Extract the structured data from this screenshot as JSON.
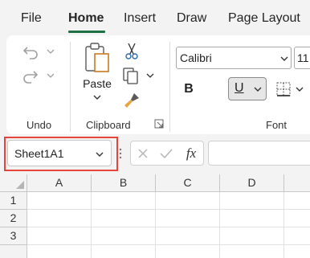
{
  "menu": {
    "tabs": [
      {
        "label": "File"
      },
      {
        "label": "Home"
      },
      {
        "label": "Insert"
      },
      {
        "label": "Draw"
      },
      {
        "label": "Page Layout"
      }
    ],
    "active_tab": "Home"
  },
  "ribbon": {
    "undo_group_label": "Undo",
    "clipboard_group_label": "Clipboard",
    "paste_label": "Paste",
    "font_group_label": "Font",
    "font_name": "Calibri",
    "font_size": "11",
    "bold_label": "B",
    "underline_label": "U"
  },
  "formula_bar": {
    "name_box_value": "Sheet1A1",
    "fx_label": "fx",
    "formula_value": ""
  },
  "sheet": {
    "columns": [
      "A",
      "B",
      "C",
      "D"
    ],
    "rows": [
      "1",
      "2",
      "3"
    ]
  },
  "colors": {
    "accent": "#1e7145",
    "highlight": "#e5453b"
  }
}
